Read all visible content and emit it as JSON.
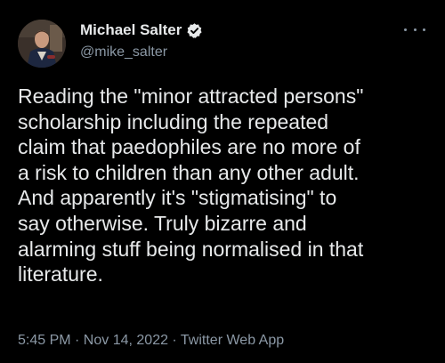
{
  "author": {
    "display_name": "Michael Salter",
    "handle": "@mike_salter",
    "verified_icon": "verified-badge-icon",
    "avatar_icon": "profile-photo-avatar"
  },
  "more_icon": "more-options-icon",
  "tweet": {
    "lines": [
      "Reading the \"minor attracted persons\"",
      "scholarship including the repeated",
      "claim that paedophiles are no more of",
      "a risk to children than any other adult.",
      "And apparently it's \"stigmatising\" to",
      "say otherwise. Truly bizarre and",
      "alarming stuff being normalised in that",
      "literature."
    ]
  },
  "meta": {
    "text": "5:45 PM · Nov 14, 2022 · Twitter Web App"
  },
  "colors": {
    "background": "#000000",
    "text": "#e7e9ea",
    "muted": "#8b98a5"
  }
}
